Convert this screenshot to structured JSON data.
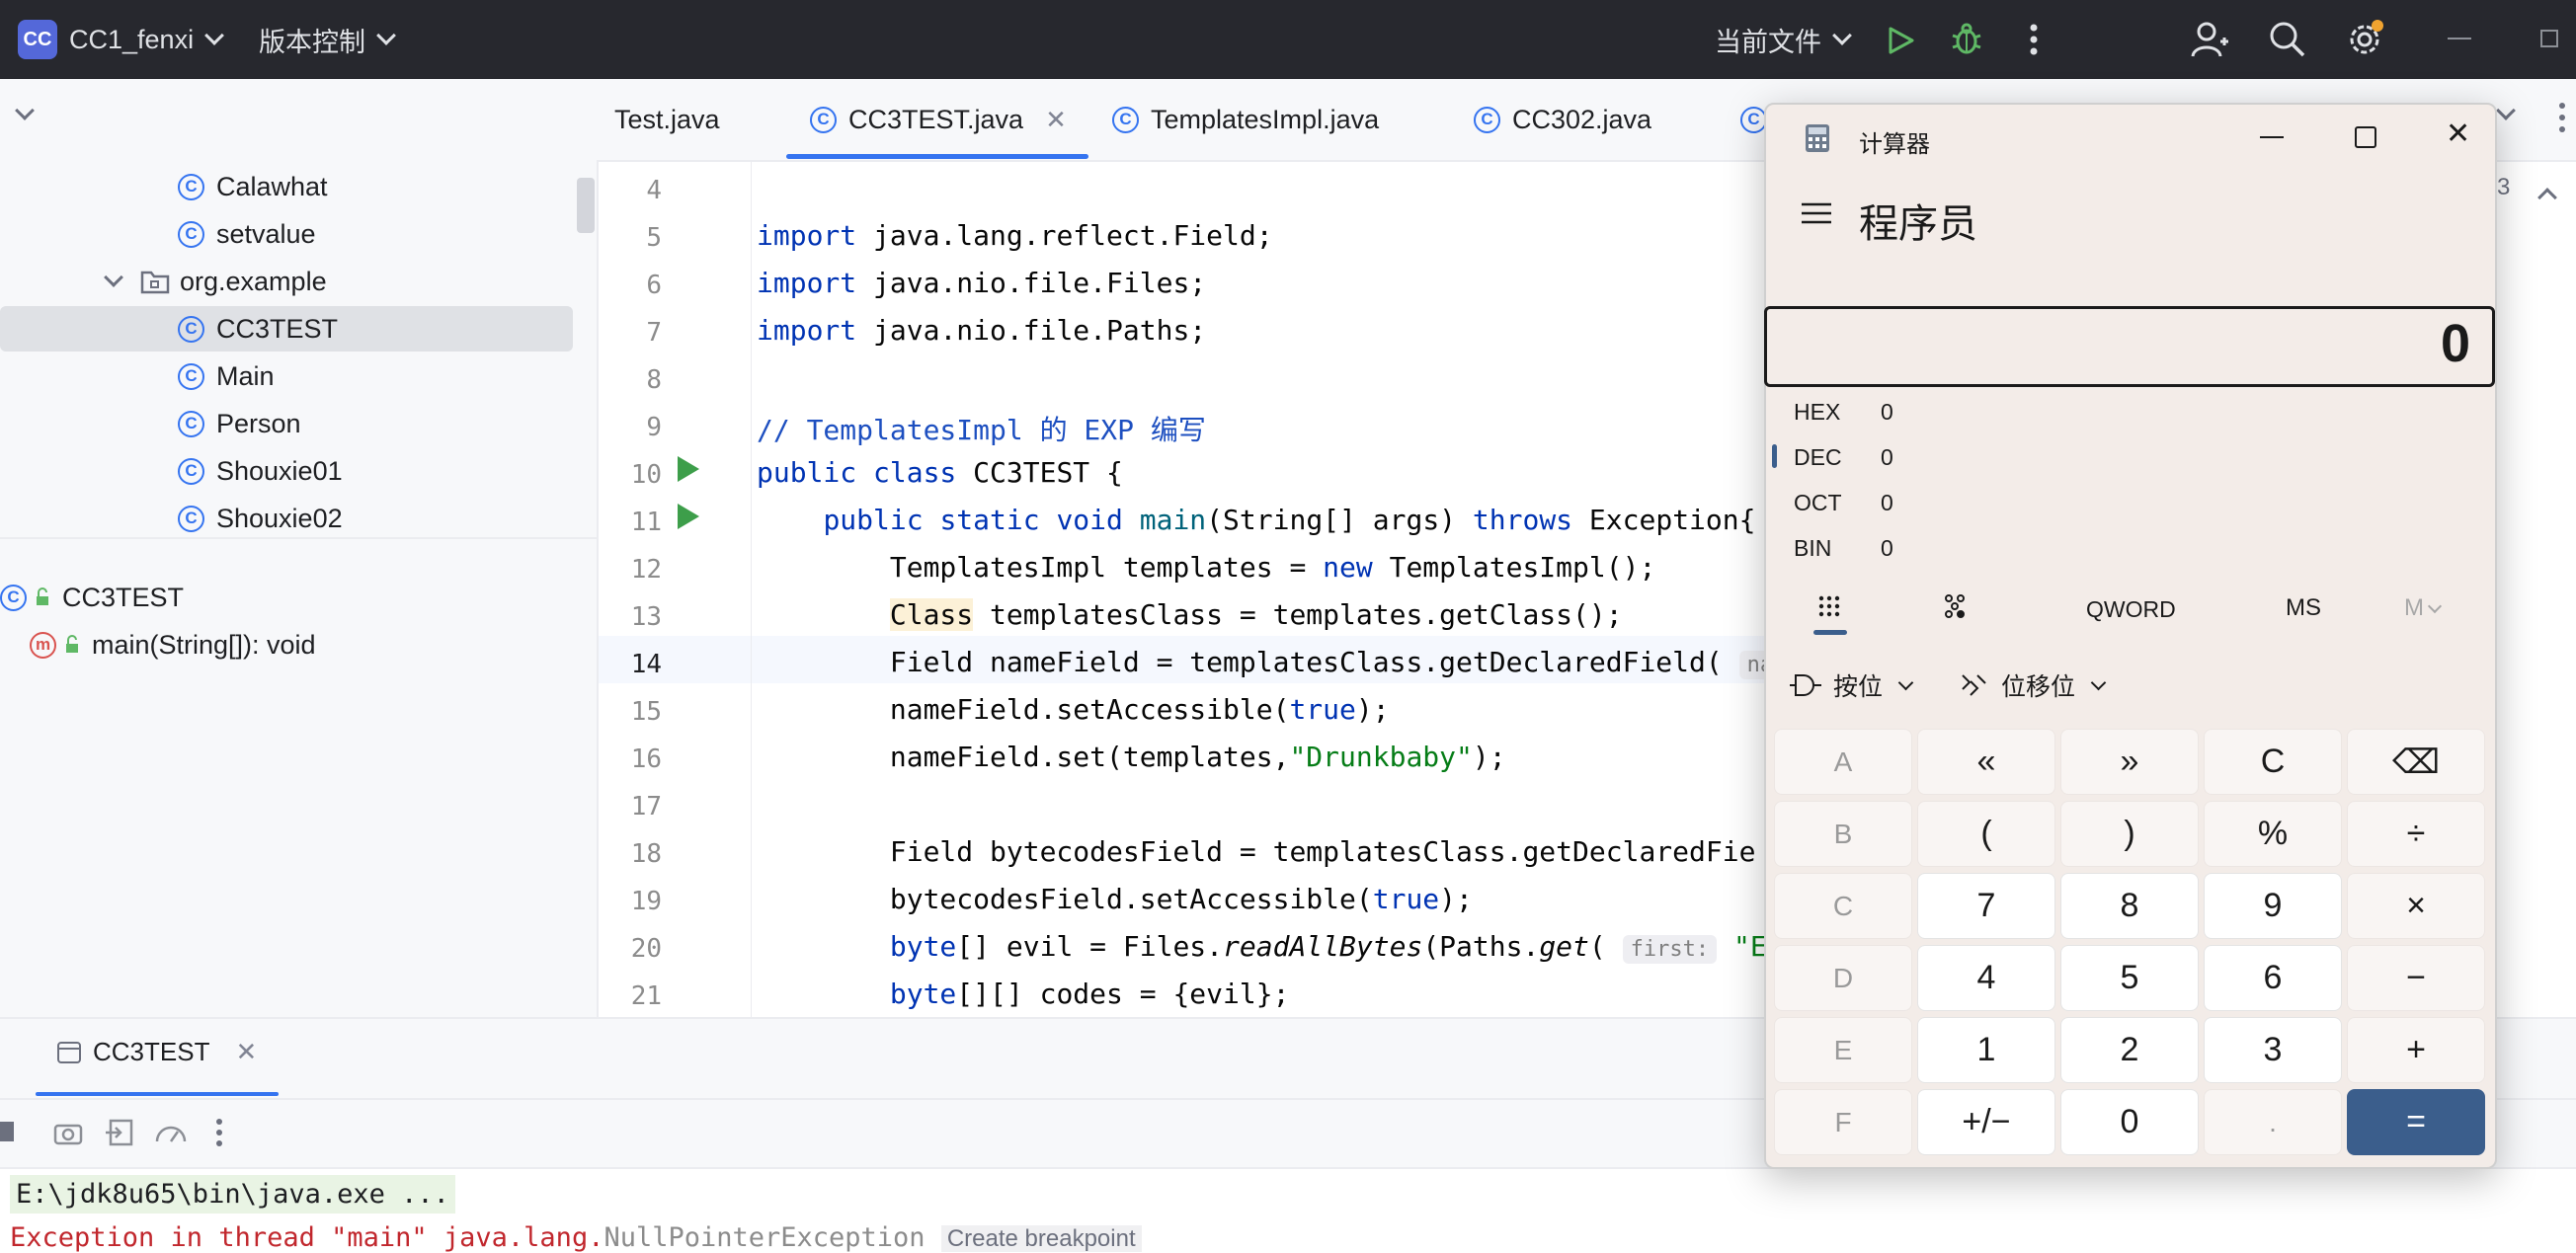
{
  "titlebar": {
    "project_badge": "CC",
    "project_name": "CC1_fenxi",
    "vcs_label": "版本控制",
    "run_config": "当前文件",
    "icons": [
      "run-icon",
      "debug-icon",
      "more-icon",
      "add-user-icon",
      "search-icon",
      "settings-icon",
      "minimize-icon",
      "maximize-icon"
    ]
  },
  "editor_tabs": [
    {
      "label": "Test.java",
      "active": false
    },
    {
      "label": "CC3TEST.java",
      "active": true
    },
    {
      "label": "TemplatesImpl.java",
      "active": false
    },
    {
      "label": "CC302.java",
      "active": false
    }
  ],
  "project_tree": {
    "items": [
      {
        "label": "Calawhat",
        "type": "class"
      },
      {
        "label": "setvalue",
        "type": "class"
      },
      {
        "label": "org.example",
        "type": "package"
      },
      {
        "label": "CC3TEST",
        "type": "class",
        "selected": true
      },
      {
        "label": "Main",
        "type": "class"
      },
      {
        "label": "Person",
        "type": "class"
      },
      {
        "label": "Shouxie01",
        "type": "class"
      },
      {
        "label": "Shouxie02",
        "type": "class"
      }
    ]
  },
  "structure": {
    "class_name": "CC3TEST",
    "method": "main(String[]): void",
    "method_icon": "m"
  },
  "editor": {
    "line_numbers": [
      "4",
      "5",
      "6",
      "7",
      "8",
      "9",
      "10",
      "11",
      "12",
      "13",
      "14",
      "15",
      "16",
      "17",
      "18",
      "19",
      "20",
      "21"
    ],
    "current_line": "14",
    "right_gutter_count": "3",
    "hint_first": "first:",
    "hint_na": "na"
  },
  "run_panel": {
    "tab_label": "CC3TEST",
    "command": "E:\\jdk8u65\\bin\\java.exe ...",
    "exception_prefix": "Exception in thread \"main\" java.lang.",
    "exception_class": "NullPointerException",
    "create_breakpoint": "Create breakpoint"
  },
  "calculator": {
    "window_title": "计算器",
    "mode_title": "程序员",
    "display_value": "0",
    "radix": [
      {
        "label": "HEX",
        "value": "0",
        "active": false
      },
      {
        "label": "DEC",
        "value": "0",
        "active": true
      },
      {
        "label": "OCT",
        "value": "0",
        "active": false
      },
      {
        "label": "BIN",
        "value": "0",
        "active": false
      }
    ],
    "word_size": "QWORD",
    "memory_store": "MS",
    "memory_menu": "M",
    "bitwise_label": "按位",
    "bitshift_label": "位移位",
    "keys": [
      [
        "A",
        "«",
        "»",
        "C",
        "⌫"
      ],
      [
        "B",
        "(",
        ")",
        "%",
        "÷"
      ],
      [
        "C",
        "7",
        "8",
        "9",
        "×"
      ],
      [
        "D",
        "4",
        "5",
        "6",
        "−"
      ],
      [
        "E",
        "1",
        "2",
        "3",
        "+"
      ],
      [
        "F",
        "+/−",
        "0",
        ".",
        "="
      ]
    ],
    "accent_color": "#3b5e8c"
  }
}
